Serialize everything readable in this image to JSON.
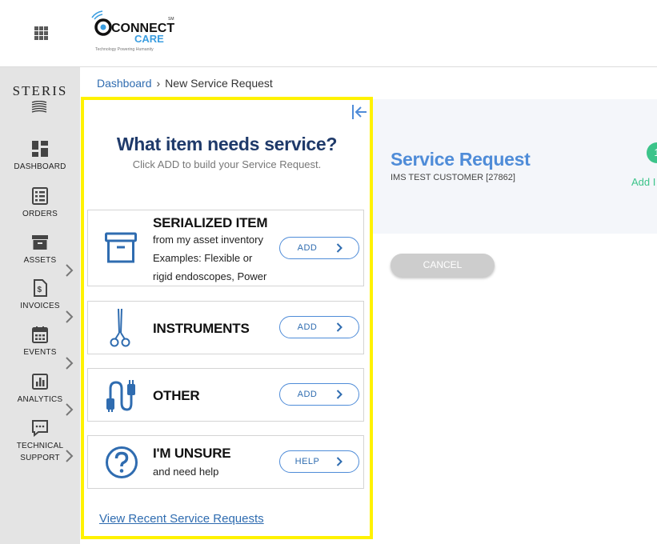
{
  "header": {
    "apps_icon": "apps-grid-icon",
    "logo": {
      "line1": "CONNECT",
      "line2": "CARE",
      "sm": "SM",
      "tagline": "Technology Powering Humanity"
    }
  },
  "sidebar": {
    "brand": "STERIS",
    "items": [
      {
        "label": "DASHBOARD",
        "icon": "dashboard-icon",
        "has_submenu": false
      },
      {
        "label": "ORDERS",
        "icon": "orders-icon",
        "has_submenu": true
      },
      {
        "label": "ASSETS",
        "icon": "assets-icon",
        "has_submenu": true
      },
      {
        "label": "INVOICES",
        "icon": "invoices-icon",
        "has_submenu": true
      },
      {
        "label": "EVENTS",
        "icon": "events-icon",
        "has_submenu": true
      },
      {
        "label": "ANALYTICS",
        "icon": "analytics-icon",
        "has_submenu": true
      },
      {
        "label_line1": "TECHNICAL",
        "label_line2": "SUPPORT",
        "icon": "technical-support-icon",
        "has_submenu": false
      }
    ]
  },
  "breadcrumb": {
    "root": "Dashboard",
    "separator": "›",
    "current": "New Service Request"
  },
  "main": {
    "title": "Service Request",
    "customer": "IMS TEST CUSTOMER [27862]",
    "add_partial": "Add I",
    "step_partial": "1",
    "cancel_label": "CANCEL"
  },
  "panel": {
    "title": "What item needs service?",
    "subtitle": "Click ADD to build your Service Request.",
    "cards": [
      {
        "title": "SERIALIZED ITEM",
        "line1": "from my asset inventory",
        "line2": "Examples: Flexible or",
        "line3": "rigid endoscopes, Power",
        "button": "ADD",
        "icon": "archive-box-icon"
      },
      {
        "title": "INSTRUMENTS",
        "button": "ADD",
        "icon": "surgical-scissors-icon"
      },
      {
        "title": "OTHER",
        "button": "ADD",
        "icon": "cable-plug-icon"
      },
      {
        "title": "I'M UNSURE",
        "line1": "and need help",
        "button": "HELP",
        "icon": "question-circle-icon"
      }
    ],
    "recent_link": "View Recent Service Requests"
  },
  "colors": {
    "brand_blue": "#4f8cd8",
    "link_blue": "#2f6cb0",
    "title_navy": "#1f3a6a",
    "highlight_yellow": "#fff200",
    "accent_green": "#3cc48a",
    "sidebar_bg": "#e4e4e4"
  }
}
